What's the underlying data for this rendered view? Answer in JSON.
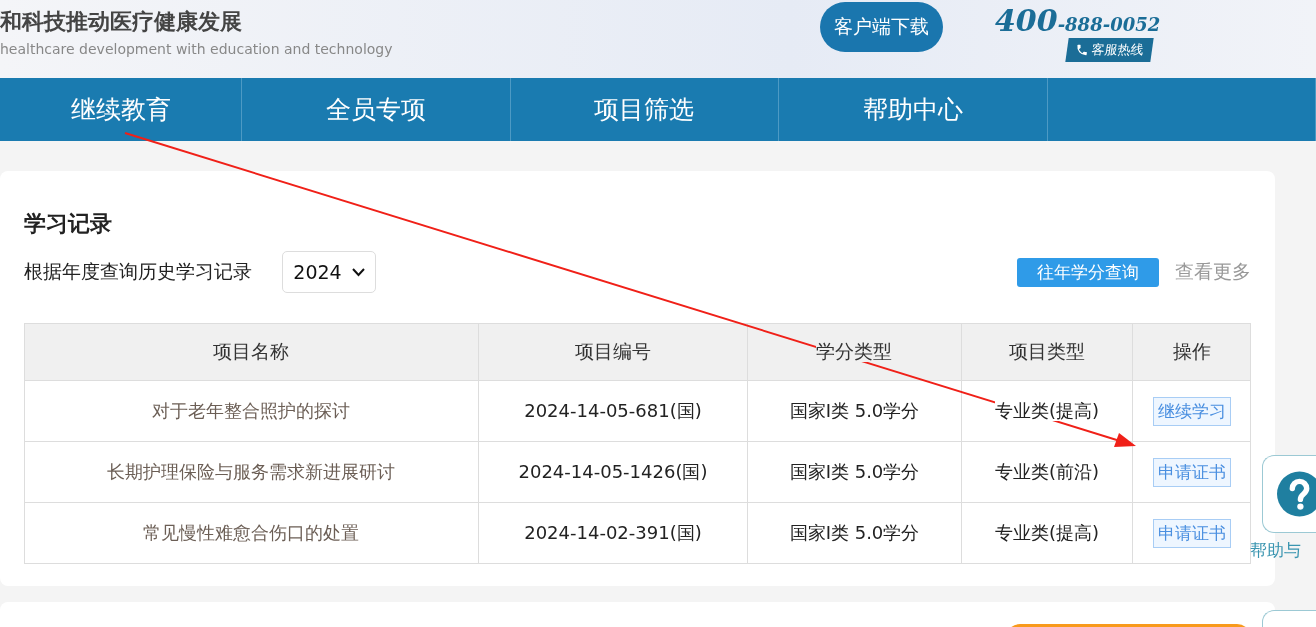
{
  "header": {
    "slogan": "和科技推动医疗健康发展",
    "subtitle": "healthcare development with education and technology",
    "download_button": "客户端下载",
    "hotline": {
      "prefix": "400",
      "number": "-888-0052",
      "label": "客服热线"
    }
  },
  "nav": {
    "items": [
      {
        "label": "继续教育"
      },
      {
        "label": "全员专项"
      },
      {
        "label": "项目筛选"
      },
      {
        "label": "帮助中心"
      }
    ]
  },
  "records": {
    "title": "学习记录",
    "filter_label": "根据年度查询历史学习记录",
    "year": "2024",
    "query_button": "往年学分查询",
    "more_link": "查看更多",
    "table": {
      "columns": [
        "项目名称",
        "项目编号",
        "学分类型",
        "项目类型",
        "操作"
      ],
      "rows": [
        {
          "name": "对于老年整合照护的探讨",
          "code": "2024-14-05-681(国)",
          "credit": "国家I类 5.0学分",
          "type": "专业类(提高)",
          "action": "继续学习"
        },
        {
          "name": "长期护理保险与服务需求新进展研讨",
          "code": "2024-14-05-1426(国)",
          "credit": "国家I类 5.0学分",
          "type": "专业类(前沿)",
          "action": "申请证书"
        },
        {
          "name": "常见慢性难愈合伤口的处置",
          "code": "2024-14-02-391(国)",
          "credit": "国家I类 5.0学分",
          "type": "专业类(提高)",
          "action": "申请证书"
        }
      ]
    }
  },
  "help_widget": {
    "label": "帮助与"
  },
  "annotation": {
    "kind": "arrow"
  }
}
